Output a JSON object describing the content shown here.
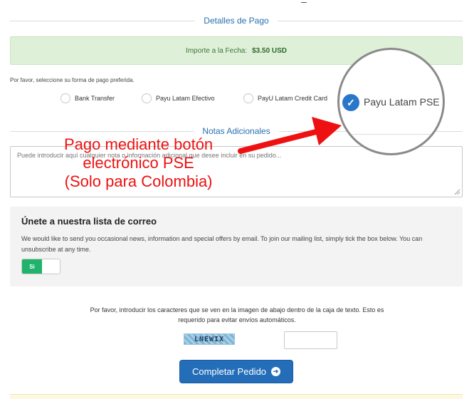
{
  "payment_section": {
    "title": "Detalles de Pago",
    "amount_label": "Importe a la Fecha:",
    "amount_value": "$3.50 USD",
    "prompt": "Por favor, seleccione su forma de pago preferida.",
    "options": [
      {
        "label": "Bank Transfer",
        "selected": false
      },
      {
        "label": "Payu Latam Efectivo",
        "selected": false
      },
      {
        "label": "PayU Latam Credit Card",
        "selected": false
      },
      {
        "label": "Payu Latam PSE",
        "selected": true
      }
    ]
  },
  "notes_section": {
    "title": "Notas Adicionales",
    "placeholder": "Puede introducir aquí cualquier nota o información adicional que desee incluir en su pedido..."
  },
  "mailing_list": {
    "title": "Únete a nuestra lista de correo",
    "description": "We would like to send you occasional news, information and special offers by email. To join our mailing list, simply tick the box below. You can unsubscribe at any time.",
    "toggle_on_label": "Si",
    "toggle_state": "on"
  },
  "captcha": {
    "instructions": "Por favor, introducir los caracteres que se ven en la imagen de abajo dentro de la caja de texto. Esto es requerido para evitar envíos automáticos.",
    "image_text": "LNEWIX",
    "input_value": ""
  },
  "submit": {
    "label": "Completar Pedido",
    "icon": "arrow-circle-right-icon"
  },
  "annotation": {
    "lines": [
      "Pago mediante botón",
      "electrónico PSE",
      "(Solo para Colombia)"
    ],
    "color": "#ee1111"
  },
  "colors": {
    "accent": "#246eb9",
    "success_bg": "#dff0d8",
    "toggle_on": "#1fb36b"
  }
}
